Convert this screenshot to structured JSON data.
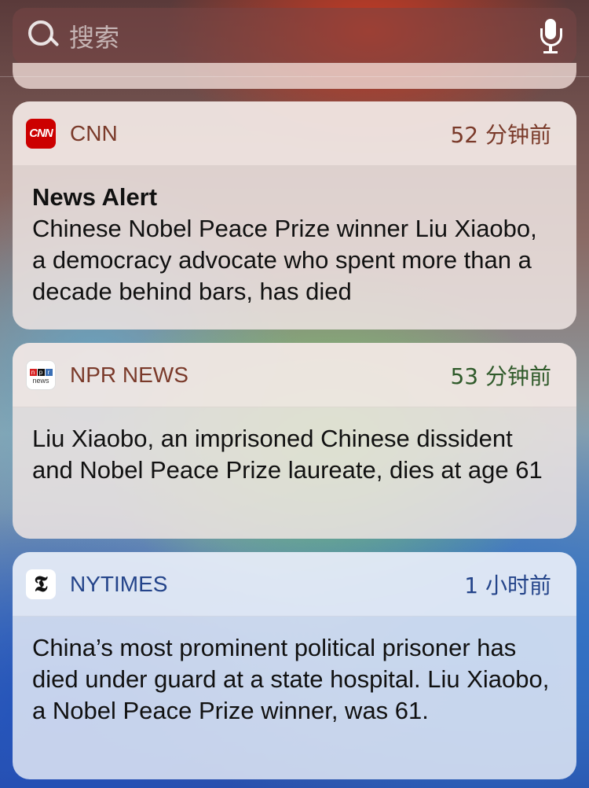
{
  "search": {
    "placeholder": "搜索"
  },
  "notifications": [
    {
      "app": "CNN",
      "time": "52 分钟前",
      "title": "News Alert",
      "body": "Chinese Nobel Peace Prize winner Liu Xiaobo, a democracy advocate who spent more than a decade behind bars, has died",
      "icon": "cnn-icon",
      "app_color": "#7a3a2a",
      "time_color": "#7a3a2a"
    },
    {
      "app": "NPR NEWS",
      "time": "53 分钟前",
      "body": "Liu Xiaobo, an imprisoned Chinese dissident and Nobel Peace Prize laureate, dies at age 61",
      "icon": "npr-icon",
      "app_color": "#7a3a2a",
      "time_color": "#2f5a2a",
      "icon_text": {
        "blocks": [
          "n",
          "p",
          "r"
        ],
        "sub": "news"
      }
    },
    {
      "app": "NYTIMES",
      "time": "1 小时前",
      "body": "China’s most prominent political prisoner has died under guard at a state hospital. Liu Xiaobo, a Nobel Peace Prize winner, was 61.",
      "icon": "nytimes-icon",
      "app_color": "#24448a",
      "time_color": "#24448a"
    }
  ],
  "colors": {
    "cnn_red": "#cc0000",
    "npr_n": "#d62021",
    "npr_p": "#111111",
    "npr_r": "#3a6fb5"
  }
}
